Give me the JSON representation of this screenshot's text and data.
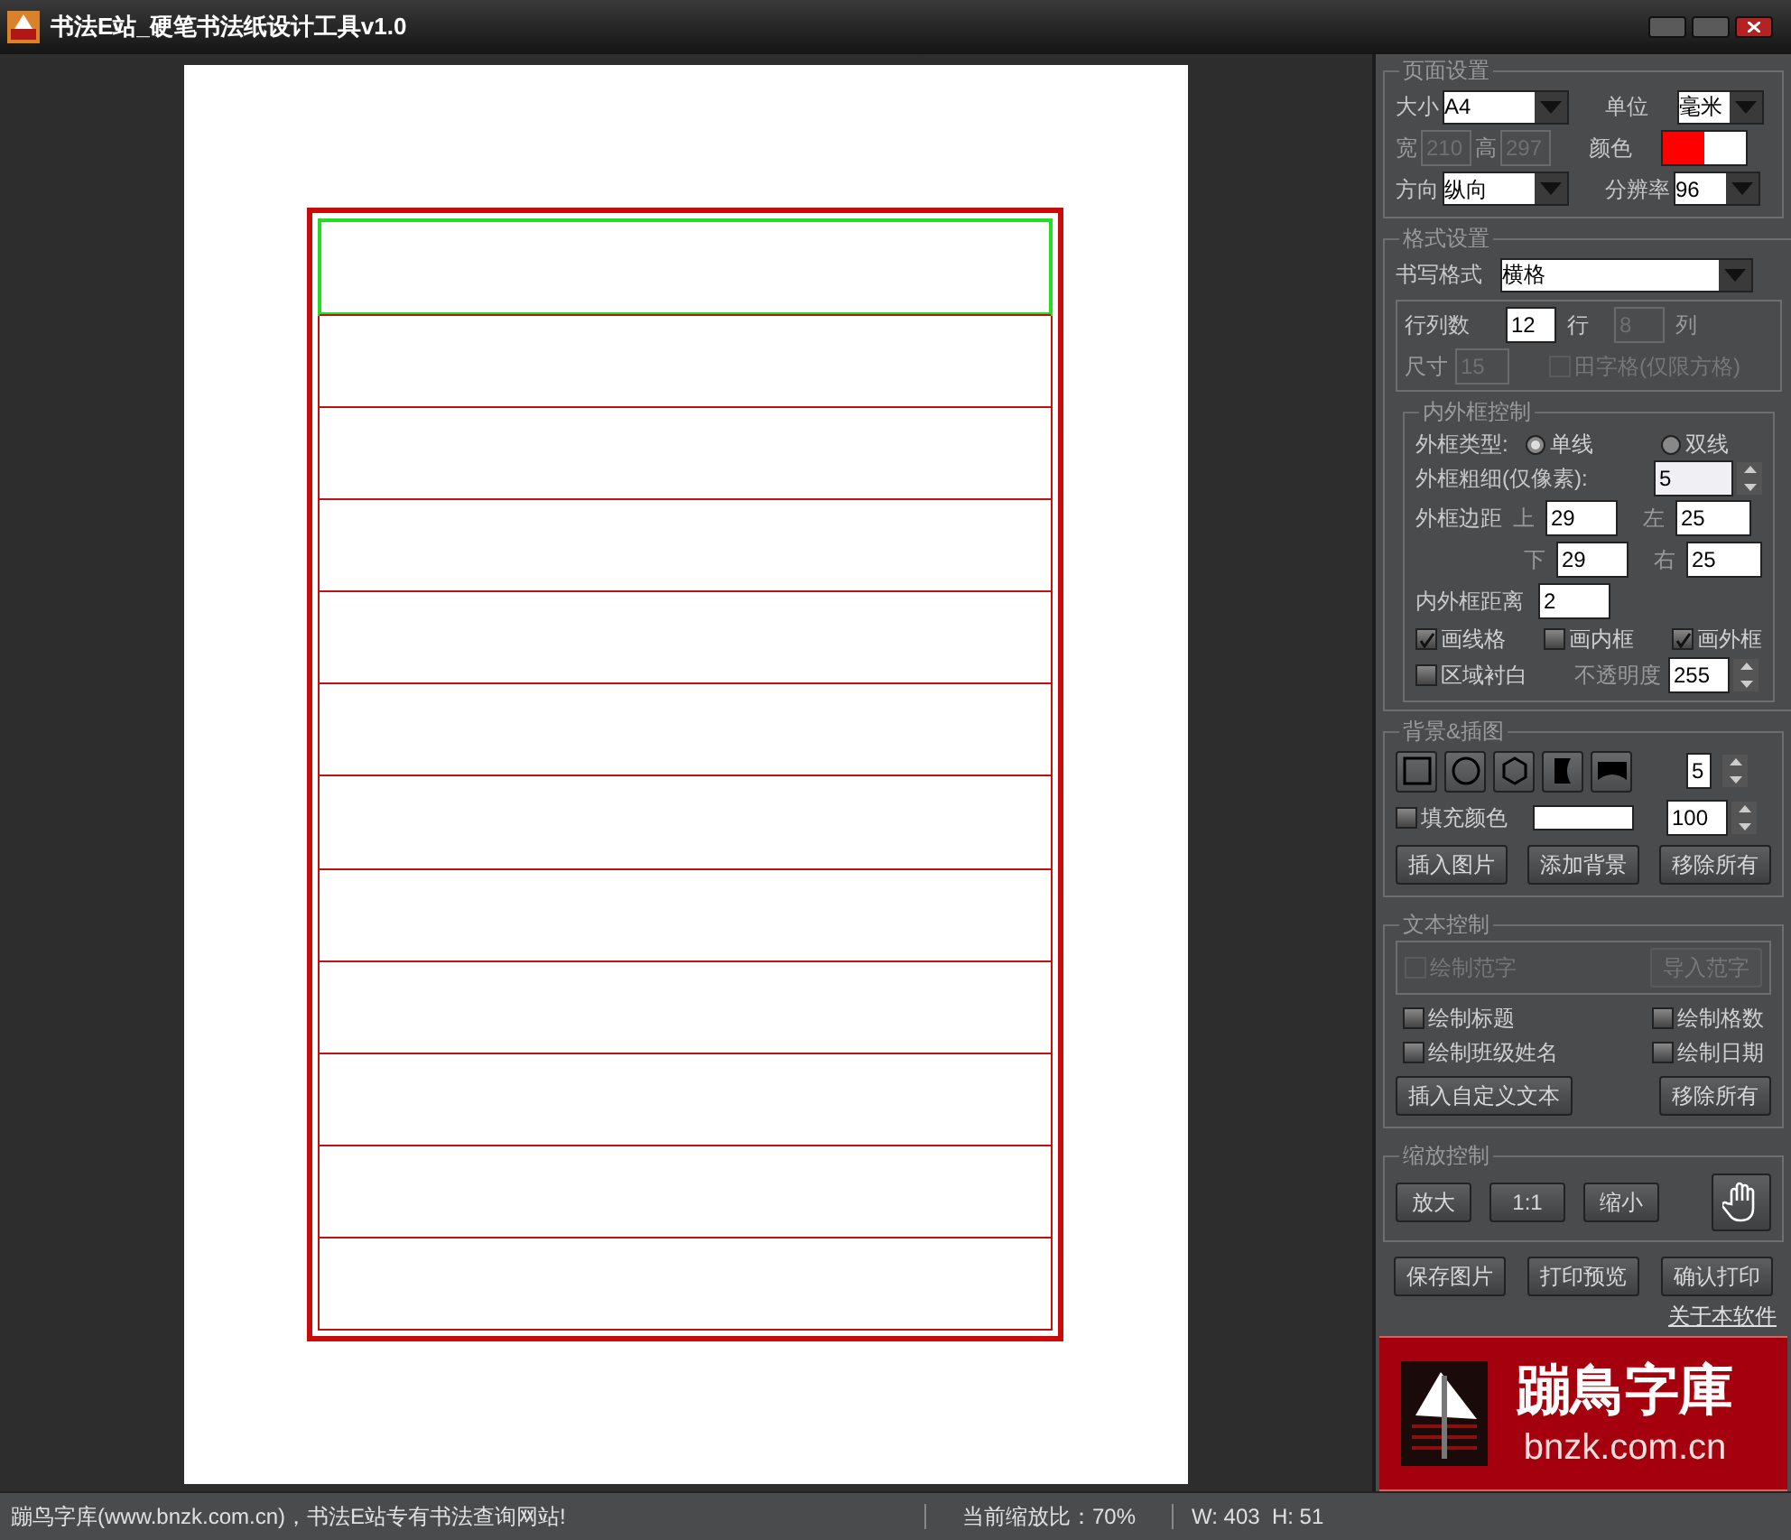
{
  "window": {
    "title": "书法E站_硬笔书法纸设计工具v1.0"
  },
  "paper": {
    "rows": [
      {
        "selected": true
      },
      {
        "selected": false
      },
      {
        "selected": false
      },
      {
        "selected": false
      },
      {
        "selected": false
      },
      {
        "selected": false
      },
      {
        "selected": false
      },
      {
        "selected": false
      },
      {
        "selected": false
      },
      {
        "selected": false
      },
      {
        "selected": false
      },
      {
        "selected": false
      }
    ]
  },
  "page_setup": {
    "title": "页面设置",
    "size": {
      "label": "大小",
      "value": "A4"
    },
    "unit": {
      "label": "单位",
      "value": "毫米"
    },
    "width": {
      "label": "宽",
      "value": "210",
      "disabled": true
    },
    "height": {
      "label": "高",
      "value": "297",
      "disabled": true
    },
    "color": {
      "label": "颜色",
      "swatches": [
        {
          "color": "#ff0000"
        },
        {
          "color": "#ffffff"
        }
      ]
    },
    "orientation": {
      "label": "方向",
      "value": "纵向"
    },
    "resolution": {
      "label": "分辨率",
      "value": "96"
    }
  },
  "format_setup": {
    "title": "格式设置",
    "writing_format": {
      "label": "书写格式",
      "value": "横格"
    },
    "rows": {
      "label": "行列数",
      "value": "12",
      "unit": "行"
    },
    "columns": {
      "value": "8",
      "unit": "列",
      "disabled": true
    },
    "cell_size": {
      "label": "尺寸",
      "value": "15",
      "disabled": true
    },
    "tianzige": {
      "label": "田字格(仅限方格)",
      "checked": false,
      "disabled": true
    }
  },
  "frame_control": {
    "title": "内外框控制",
    "frame_type": {
      "label": "外框类型:",
      "options": [
        {
          "label": "单线",
          "selected": true
        },
        {
          "label": "双线",
          "selected": false
        }
      ]
    },
    "thickness": {
      "label": "外框粗细(仅像素):",
      "value": "5"
    },
    "margins": {
      "label": "外框边距",
      "top": {
        "label": "上",
        "value": "29"
      },
      "left": {
        "label": "左",
        "value": "25"
      },
      "bottom": {
        "label": "下",
        "value": "29"
      },
      "right": {
        "label": "右",
        "value": "25"
      }
    },
    "inner_distance": {
      "label": "内外框距离",
      "value": "2"
    },
    "checkboxes": [
      {
        "label": "画线格",
        "checked": true
      },
      {
        "label": "画内框",
        "checked": false
      },
      {
        "label": "画外框",
        "checked": true
      }
    ],
    "white_area": {
      "label": "区域衬白",
      "checked": false
    },
    "opacity": {
      "label": "不透明度",
      "value": "255"
    }
  },
  "background": {
    "title": "背景&插图",
    "shapes": [
      {
        "kind": "square"
      },
      {
        "kind": "circle"
      },
      {
        "kind": "hexagon"
      },
      {
        "kind": "notch"
      },
      {
        "kind": "arch"
      }
    ],
    "sides": {
      "value": "5"
    },
    "fill": {
      "label": "填充颜色",
      "checked": false,
      "color": "#ffffff"
    },
    "fill_opacity": {
      "value": "100"
    },
    "buttons": [
      "插入图片",
      "添加背景",
      "移除所有"
    ]
  },
  "text_control": {
    "title": "文本控制",
    "sample": {
      "label": "绘制范字",
      "checked": false,
      "disabled": true
    },
    "import_button": {
      "label": "导入范字",
      "disabled": true
    },
    "checkboxes": [
      {
        "label": "绘制标题",
        "checked": false
      },
      {
        "label": "绘制格数",
        "checked": false
      },
      {
        "label": "绘制班级姓名",
        "checked": false
      },
      {
        "label": "绘制日期",
        "checked": false
      }
    ],
    "buttons": [
      "插入自定义文本",
      "移除所有"
    ]
  },
  "zoom_control": {
    "title": "缩放控制",
    "buttons": [
      "放大",
      "1:1",
      "缩小"
    ]
  },
  "actions": [
    "保存图片",
    "打印预览",
    "确认打印"
  ],
  "about_link": "关于本软件",
  "logo": {
    "name": "蹦鳥字庫",
    "url": "bnzk.com.cn"
  },
  "status_bar": {
    "message": "蹦鸟字库(www.bnzk.com.cn)，书法E站专有书法查询网站!",
    "zoom": "当前缩放比：70%",
    "size": "W: 403  H: 51"
  }
}
